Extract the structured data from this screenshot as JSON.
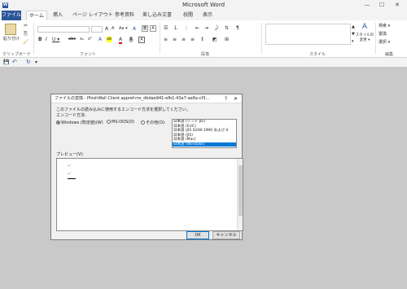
{
  "window": {
    "app_icon": "W",
    "title": "Microsoft Word",
    "minimize_glyph": "—",
    "maximize_glyph": "☐",
    "close_glyph": "✕"
  },
  "tabs": [
    "ファイル",
    "ホーム",
    "挿入",
    "ページ レイアウト",
    "参考資料",
    "差し込み文書",
    "校閲",
    "表示"
  ],
  "ribbon": {
    "paste_label": "貼り付け",
    "groups": [
      "クリップボード",
      "フォント",
      "段落",
      "スタイル",
      "編集"
    ],
    "styles_label": "スタイルの\n変更 ▾",
    "edit_items": [
      "検索 ▾",
      "置換",
      "選択 ▾"
    ],
    "font_buttons": [
      "A",
      "A",
      "Aa ▾",
      "A"
    ],
    "format_buttons": [
      "B",
      "I",
      "U ▾",
      "abc",
      "x₂",
      "x²"
    ],
    "color_buttons": [
      "A",
      "ab",
      "A",
      "A"
    ],
    "para_buttons": [
      "≡",
      "≡",
      "≡",
      "≡",
      "↕",
      "◩",
      "⊞"
    ]
  },
  "qat": {
    "save_glyph": "💾",
    "undo_glyph": "↶",
    "redo_glyph": "↻",
    "menu_glyph": "▾"
  },
  "dialog": {
    "title": "ファイルの変換 - PhishWall Client.appref-ms_dbdae941-efb1-43a7-ae6a-cf3...",
    "help_glyph": "?",
    "close_glyph": "✕",
    "instruction": "このファイルの読み込みに使用するエンコード方法を選択してください。",
    "encoding_label": "エンコード方法:",
    "radio_windows": "Windows (既定値)(W)",
    "radio_msdos": "MS-DOS(D)",
    "radio_other": "その他(O):",
    "encodings": [
      "日本語 (シフト JIS)",
      "日本語 (EUC)",
      "日本語 (JIS 0208-1990 および 0",
      "日本語 (JIS)",
      "日本語 (Mac)",
      "日本語 (Windows)"
    ],
    "preview_label": "プレビュー(V):",
    "preview_lines": [
      "↵",
      "↵"
    ],
    "ok": "OK",
    "cancel": "キャンセル"
  },
  "colors": {
    "brand": "#2b579a",
    "selection": "#0078d7"
  }
}
